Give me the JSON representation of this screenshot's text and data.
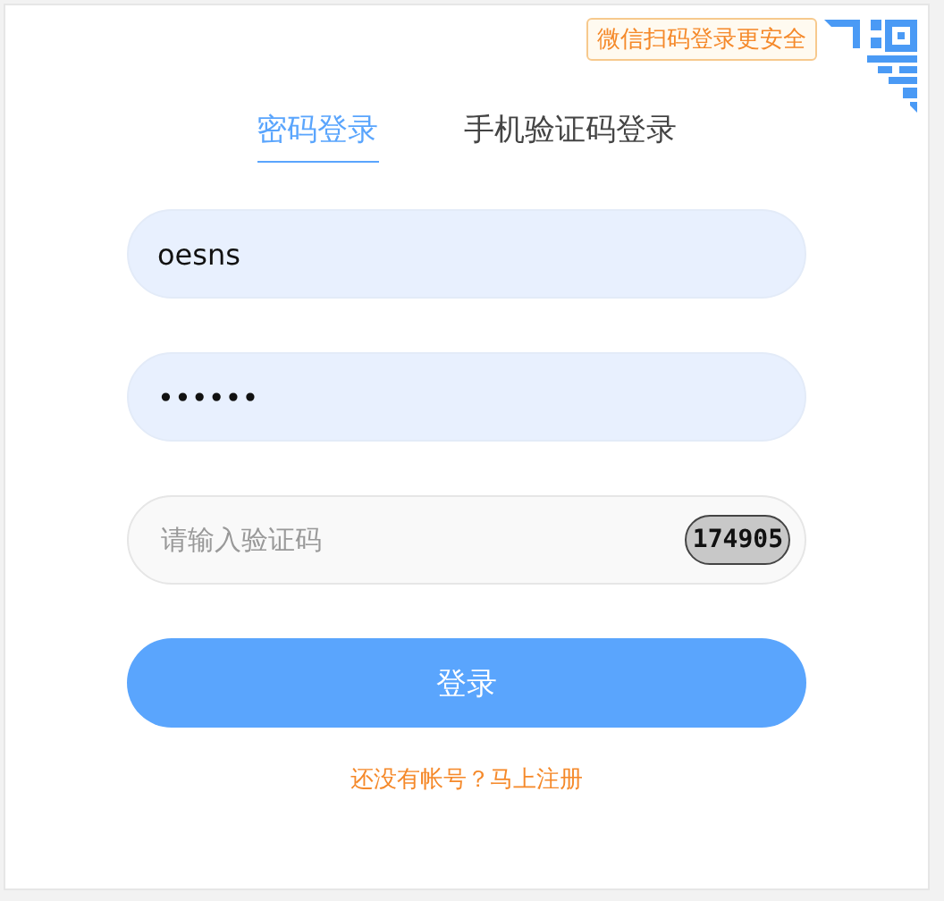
{
  "qr_hint": "微信扫码登录更安全",
  "tabs": [
    {
      "label": "密码登录",
      "selected": true
    },
    {
      "label": "手机验证码登录",
      "selected": false
    }
  ],
  "username": {
    "value": "oesns"
  },
  "password": {
    "value": "••••••"
  },
  "captcha": {
    "placeholder": "请输入验证码",
    "code": "174905"
  },
  "submit": "登录",
  "register_link": "还没有帐号？马上注册"
}
